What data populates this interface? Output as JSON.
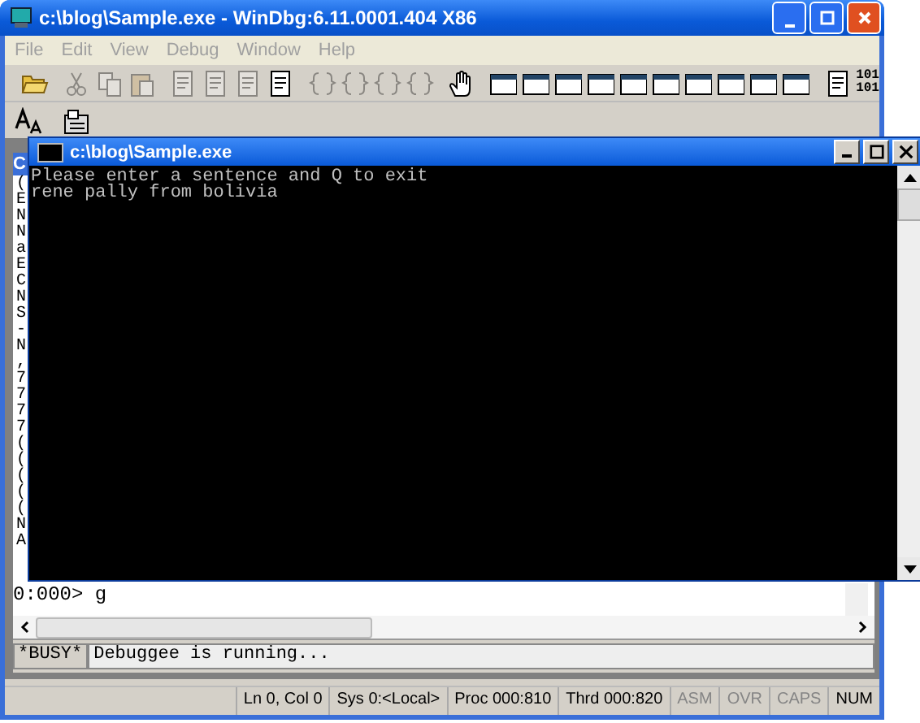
{
  "window": {
    "title": "c:\\blog\\Sample.exe - WinDbg:6.11.0001.404 X86"
  },
  "menu": [
    {
      "label": "File",
      "disabled": true
    },
    {
      "label": "Edit",
      "disabled": true
    },
    {
      "label": "View",
      "disabled": true
    },
    {
      "label": "Debug",
      "disabled": true
    },
    {
      "label": "Window",
      "disabled": true
    },
    {
      "label": "Help",
      "disabled": true
    }
  ],
  "toolbar": [
    {
      "kind": "folder",
      "disabled": false
    },
    {
      "kind": "sep"
    },
    {
      "kind": "cut",
      "disabled": true
    },
    {
      "kind": "copy",
      "disabled": true
    },
    {
      "kind": "paste",
      "disabled": true
    },
    {
      "kind": "sep"
    },
    {
      "kind": "doc",
      "disabled": true
    },
    {
      "kind": "doc",
      "disabled": true
    },
    {
      "kind": "doc",
      "disabled": true
    },
    {
      "kind": "doc",
      "disabled": false
    },
    {
      "kind": "sep"
    },
    {
      "kind": "brace",
      "disabled": true
    },
    {
      "kind": "brace",
      "disabled": true
    },
    {
      "kind": "brace",
      "disabled": true
    },
    {
      "kind": "brace",
      "disabled": true
    },
    {
      "kind": "sep"
    },
    {
      "kind": "hand",
      "disabled": false
    },
    {
      "kind": "sep"
    },
    {
      "kind": "win",
      "disabled": false
    },
    {
      "kind": "win",
      "disabled": false
    },
    {
      "kind": "win",
      "disabled": false
    },
    {
      "kind": "win",
      "disabled": false
    },
    {
      "kind": "win",
      "disabled": false
    },
    {
      "kind": "win",
      "disabled": false
    },
    {
      "kind": "win",
      "disabled": false
    },
    {
      "kind": "win",
      "disabled": false
    },
    {
      "kind": "win",
      "disabled": false
    },
    {
      "kind": "win",
      "disabled": false
    },
    {
      "kind": "sep"
    },
    {
      "kind": "doc",
      "disabled": false
    },
    {
      "kind": "text",
      "label": "101\n101"
    }
  ],
  "toolbar2": [
    {
      "kind": "font"
    },
    {
      "kind": "options"
    }
  ],
  "command_window": {
    "title": "C",
    "output_fragments": [
      "(",
      "E",
      "N",
      "N",
      "a",
      "E",
      "C",
      "N",
      "S",
      "-",
      "N",
      ",",
      "7",
      "7",
      "7",
      "7",
      "(",
      "(",
      "(",
      "(",
      "(",
      "N",
      "A"
    ],
    "prompt_line": "0:000> g",
    "busy": "*BUSY*",
    "message": "Debuggee is running..."
  },
  "console": {
    "title": "c:\\blog\\Sample.exe",
    "lines": [
      "Please enter a sentence and Q to exit",
      "rene pally from bolivia"
    ]
  },
  "status_bar": [
    {
      "label": "Ln 0, Col 0",
      "disabled": false
    },
    {
      "label": "Sys 0:<Local>",
      "disabled": false
    },
    {
      "label": "Proc 000:810",
      "disabled": false
    },
    {
      "label": "Thrd 000:820",
      "disabled": false
    },
    {
      "label": "ASM",
      "disabled": true
    },
    {
      "label": "OVR",
      "disabled": true
    },
    {
      "label": "CAPS",
      "disabled": true
    },
    {
      "label": "NUM",
      "disabled": false
    }
  ]
}
